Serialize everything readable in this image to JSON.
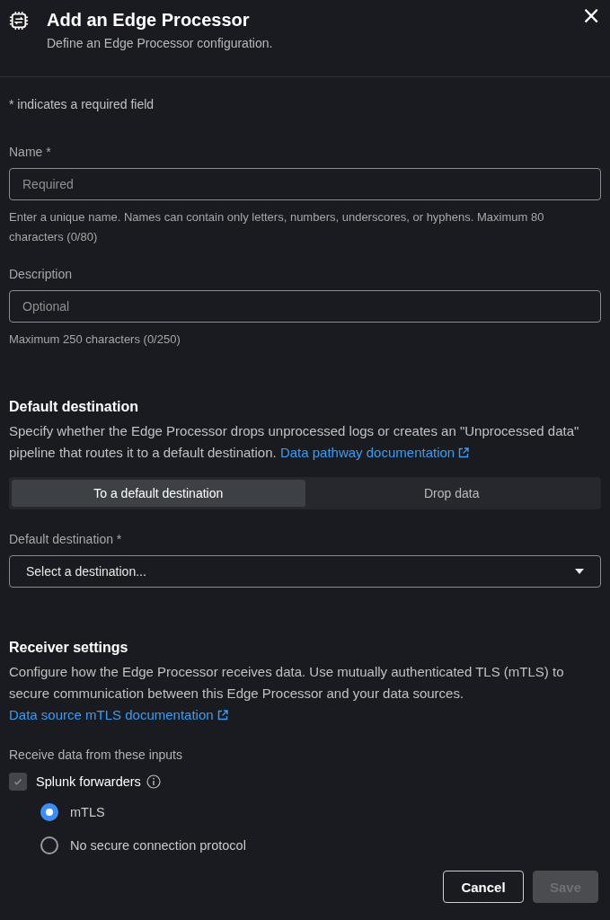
{
  "dialog": {
    "title": "Add an Edge Processor",
    "subtitle": "Define an Edge Processor configuration.",
    "close": "×"
  },
  "required_note": "* indicates a required field",
  "fields": [
    {
      "label": "Name *",
      "placeholder": "Required",
      "help": "Enter a unique name. Names can contain only letters, numbers, underscores, or hyphens. Maximum 80 characters (0/80)"
    },
    {
      "label": "Description",
      "placeholder": "Optional",
      "help": "Maximum 250 characters (0/250)"
    }
  ],
  "default_destination": {
    "heading": "Default destination",
    "text": "Specify whether the Edge Processor drops unprocessed logs or creates an \"Unprocessed data\" pipeline that routes it to a default destination.",
    "link": "Data pathway documentation",
    "options": [
      {
        "label": "To a default destination",
        "selected": true
      },
      {
        "label": "Drop data",
        "selected": false
      }
    ],
    "select_label": "Default destination *",
    "select_value": "Select a destination..."
  },
  "receiver": {
    "heading": "Receiver settings",
    "text": "Configure how the Edge Processor receives data. Use mutually authenticated TLS (mTLS) to secure communication between this Edge Processor and your data sources.",
    "link": "Data source mTLS documentation",
    "inputs_label": "Receive data from these inputs",
    "checkbox": {
      "label": "Splunk forwarders",
      "checked": true,
      "disabled": true
    },
    "protocols": [
      {
        "label": "mTLS",
        "selected": true
      },
      {
        "label": "No secure connection protocol",
        "selected": false
      }
    ]
  },
  "buttons": [
    {
      "label": "Cancel",
      "disabled": false
    },
    {
      "label": "Save",
      "disabled": true
    }
  ]
}
